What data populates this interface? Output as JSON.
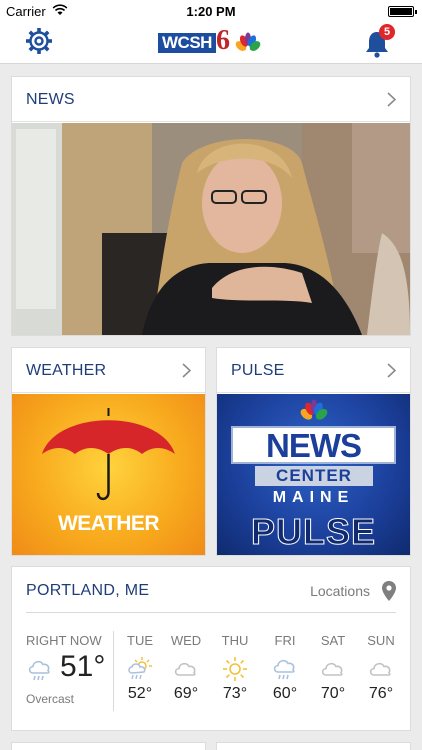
{
  "status_bar": {
    "carrier": "Carrier",
    "time": "1:20 PM"
  },
  "nav": {
    "logo_text": "WCSH",
    "logo_number": "6",
    "notification_count": "5"
  },
  "cards": {
    "news": {
      "title": "NEWS"
    },
    "weather": {
      "title": "WEATHER",
      "image_text": "WEATHER"
    },
    "pulse": {
      "title": "PULSE",
      "image_lines": [
        "NEWS",
        "CENTER",
        "MAINE",
        "PULSE"
      ]
    }
  },
  "forecast": {
    "location": "PORTLAND, ME",
    "locations_link": "Locations",
    "now": {
      "label": "RIGHT NOW",
      "temp": "51°",
      "condition": "Overcast",
      "icon": "rain-cloud-icon"
    },
    "days": [
      {
        "name": "TUE",
        "temp": "52°",
        "icon": "sun-rain-icon"
      },
      {
        "name": "WED",
        "temp": "69°",
        "icon": "cloud-icon"
      },
      {
        "name": "THU",
        "temp": "73°",
        "icon": "sun-icon"
      },
      {
        "name": "FRI",
        "temp": "60°",
        "icon": "rain-cloud-icon"
      },
      {
        "name": "SAT",
        "temp": "70°",
        "icon": "cloud-icon"
      },
      {
        "name": "SUN",
        "temp": "76°",
        "icon": "cloud-icon"
      }
    ]
  },
  "colors": {
    "title_blue": "#1f3e78",
    "brand_blue": "#1d4d9e",
    "badge_red": "#e0262a",
    "weather_orange": "#f5a623",
    "pulse_blue": "#1b3f9a"
  }
}
